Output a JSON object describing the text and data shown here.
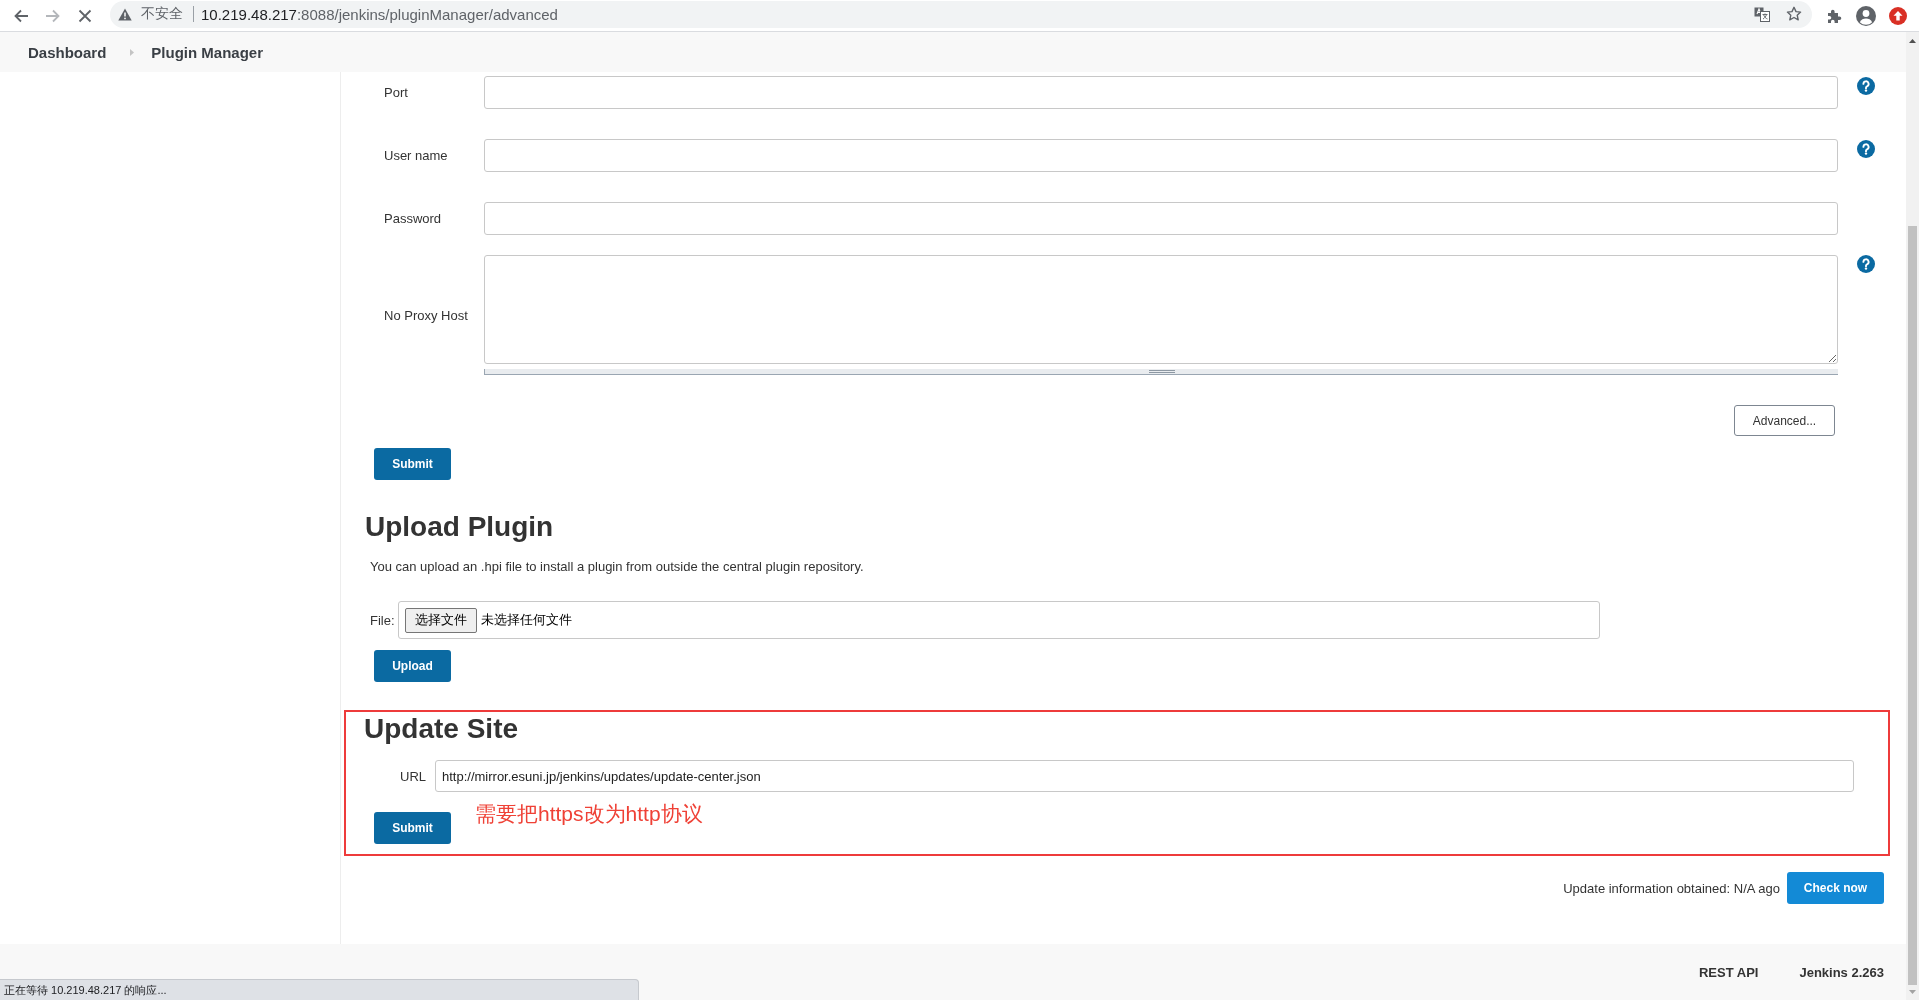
{
  "browser": {
    "loading": true,
    "forward_disabled": true,
    "security_label": "不安全",
    "url_host": "10.219.48.217",
    "url_path": ":8088/jenkins/pluginManager/advanced"
  },
  "breadcrumbs": [
    {
      "label": "Dashboard"
    },
    {
      "label": "Plugin Manager"
    }
  ],
  "proxy_form": {
    "fields": [
      {
        "label": "Port",
        "kind": "input",
        "help": true
      },
      {
        "label": "User name",
        "kind": "input",
        "help": true
      },
      {
        "label": "Password",
        "kind": "input",
        "help": false
      },
      {
        "label": "No Proxy Host",
        "kind": "textarea",
        "help": true
      }
    ],
    "advanced_button": "Advanced...",
    "submit_button": "Submit"
  },
  "upload_plugin": {
    "heading": "Upload Plugin",
    "description": "You can upload an .hpi file to install a plugin from outside the central plugin repository.",
    "file_label": "File:",
    "choose_button": "选择文件",
    "no_file_text": "未选择任何文件",
    "upload_button": "Upload"
  },
  "update_site": {
    "highlighted": true,
    "heading": "Update Site",
    "url_label": "URL",
    "url_value": "http://mirror.esuni.jp/jenkins/updates/update-center.json",
    "submit_button": "Submit",
    "annotation": "需要把https改为http协议"
  },
  "update_info": {
    "text": "Update information obtained: N/A ago",
    "check_button": "Check now"
  },
  "footer": {
    "links": [
      "REST API",
      "Jenkins 2.263"
    ]
  },
  "status_bar": {
    "text": "正在等待 10.219.48.217 的响应..."
  }
}
